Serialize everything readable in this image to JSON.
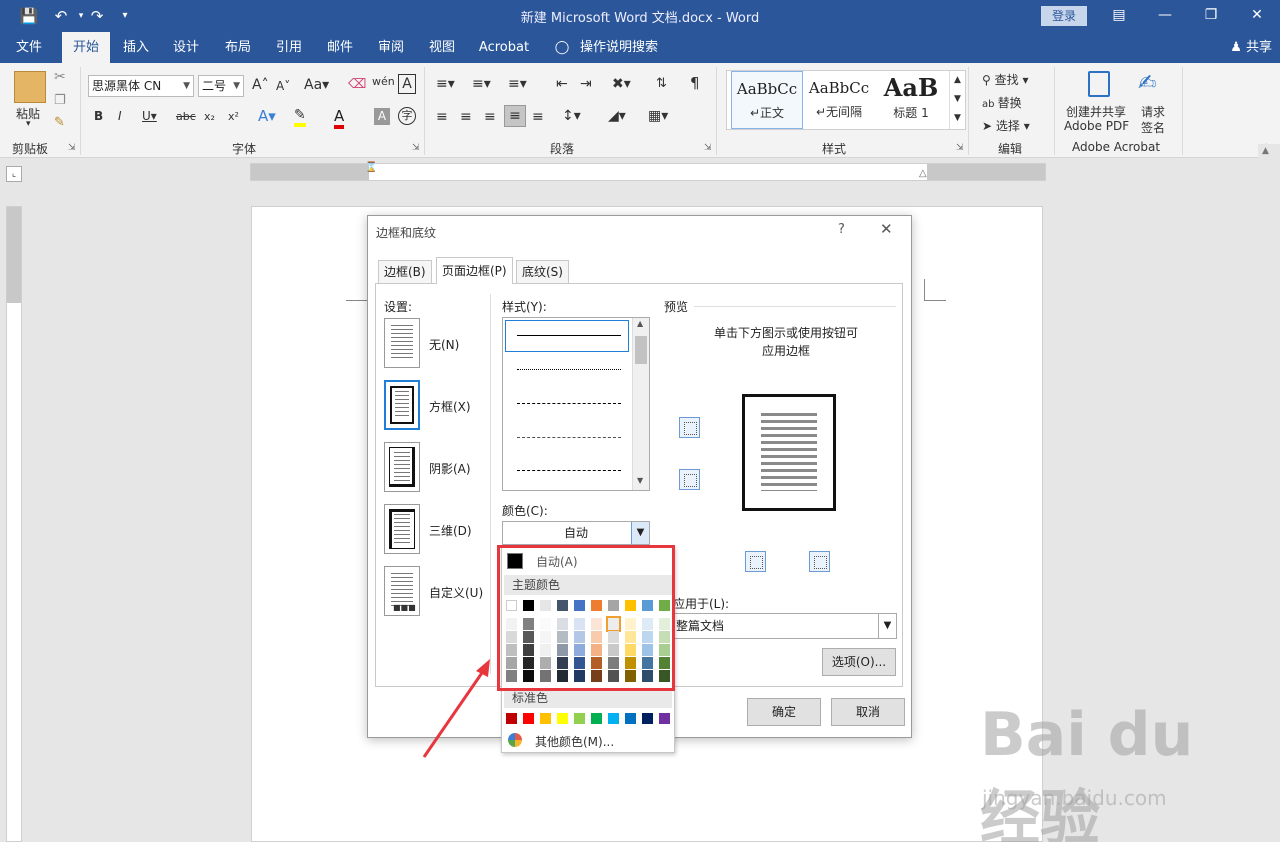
{
  "titlebar": {
    "title": "新建 Microsoft Word 文档.docx - Word",
    "login": "登录"
  },
  "tabs": [
    "文件",
    "开始",
    "插入",
    "设计",
    "布局",
    "引用",
    "邮件",
    "审阅",
    "视图",
    "Acrobat",
    "操作说明搜索"
  ],
  "share": "共享",
  "ribbon": {
    "paste": "粘贴",
    "font_name": "思源黑体 CN",
    "font_size": "二号",
    "groups": [
      "剪贴板",
      "字体",
      "段落",
      "样式",
      "编辑",
      "Adobe Acrobat"
    ],
    "styles": [
      {
        "sample": "AaBbCc",
        "name": "正文"
      },
      {
        "sample": "AaBbCc",
        "name": "无间隔"
      },
      {
        "sample": "AaB",
        "name": "标题 1"
      }
    ],
    "find": "查找",
    "replace": "替换",
    "select": "选择",
    "acrobat_create": "创建并共享",
    "acrobat_pdf": "Adobe PDF",
    "acrobat_sign1": "请求",
    "acrobat_sign2": "签名"
  },
  "dialog": {
    "title": "边框和底纹",
    "help": "?",
    "tabs": [
      "边框(B)",
      "页面边框(P)",
      "底纹(S)"
    ],
    "settings_label": "设置:",
    "settings": [
      "无(N)",
      "方框(X)",
      "阴影(A)",
      "三维(D)",
      "自定义(U)"
    ],
    "style_label": "样式(Y):",
    "color_label": "颜色(C):",
    "color_value": "自动",
    "preview_label": "预览",
    "preview_hint_1": "单击下方图示或使用按钮可",
    "preview_hint_2": "应用边框",
    "apply_label": "应用于(L):",
    "apply_value": "整篇文档",
    "options": "选项(O)...",
    "ok": "确定",
    "cancel": "取消"
  },
  "color_menu": {
    "auto": "自动(A)",
    "theme_heading": "主题颜色",
    "standard_heading": "标准色",
    "more": "其他颜色(M)...",
    "theme_top": [
      "#ffffff",
      "#000000",
      "#e7e6e6",
      "#44546a",
      "#4472c4",
      "#ed7d31",
      "#a5a5a5",
      "#ffc000",
      "#5b9bd5",
      "#70ad47"
    ],
    "standard": [
      "#c00000",
      "#ff0000",
      "#ffc000",
      "#ffff00",
      "#92d050",
      "#00b050",
      "#00b0f0",
      "#0070c0",
      "#002060",
      "#7030a0"
    ]
  },
  "watermark": {
    "big": "Bai du 经验",
    "small": "jingyan.baidu.com"
  },
  "colors": {
    "word_blue": "#2b579a",
    "highlight_red": "#e8363e",
    "selection_blue": "#1e7ed8"
  }
}
